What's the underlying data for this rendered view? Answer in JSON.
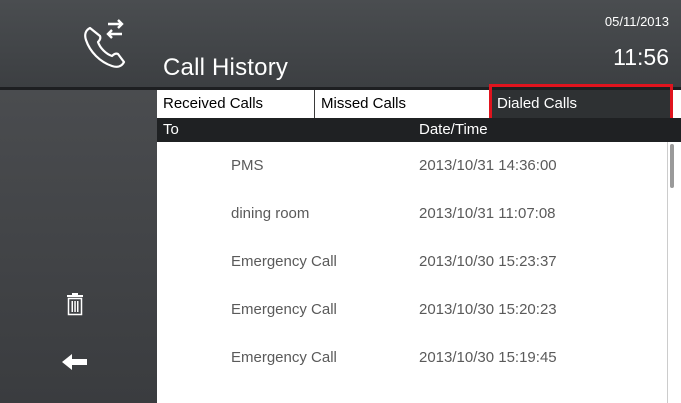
{
  "header": {
    "title": "Call History",
    "date": "05/11/2013",
    "time": "11:56",
    "icon": "phone-transfer-icon"
  },
  "tabs": [
    {
      "label": "Received Calls",
      "active": false
    },
    {
      "label": "Missed Calls",
      "active": false
    },
    {
      "label": "Dialed Calls",
      "active": true
    }
  ],
  "columns": {
    "to": "To",
    "datetime": "Date/Time"
  },
  "rows": [
    {
      "to": "PMS",
      "datetime": "2013/10/31 14:36:00"
    },
    {
      "to": "dining room",
      "datetime": "2013/10/31 11:07:08"
    },
    {
      "to": "Emergency Call",
      "datetime": "2013/10/30 15:23:37"
    },
    {
      "to": "Emergency Call",
      "datetime": "2013/10/30 15:20:23"
    },
    {
      "to": "Emergency Call",
      "datetime": "2013/10/30 15:19:45"
    }
  ],
  "sidebar": {
    "delete_icon": "trash-icon",
    "back_icon": "back-arrow-icon"
  },
  "colors": {
    "highlight": "#e0141e",
    "header_bg": "#45484b",
    "active_tab_bg": "#2e3133"
  }
}
